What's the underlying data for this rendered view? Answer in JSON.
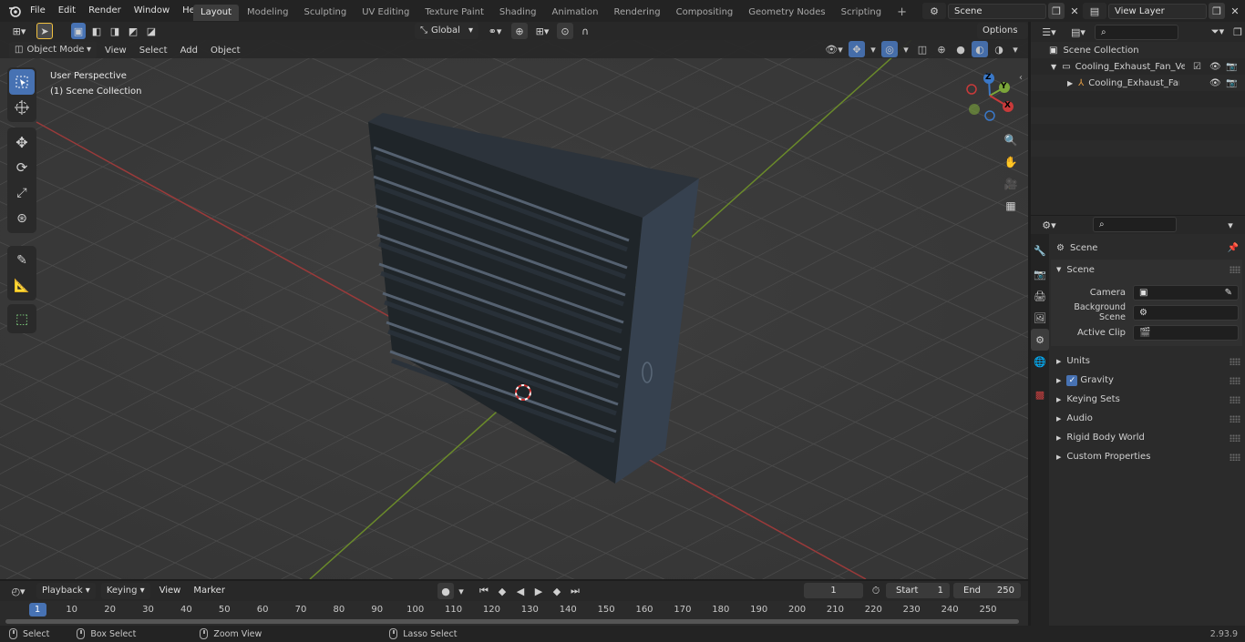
{
  "menu": [
    "File",
    "Edit",
    "Render",
    "Window",
    "Help"
  ],
  "workspaces": [
    "Layout",
    "Modeling",
    "Sculpting",
    "UV Editing",
    "Texture Paint",
    "Shading",
    "Animation",
    "Rendering",
    "Compositing",
    "Geometry Nodes",
    "Scripting"
  ],
  "active_workspace": "Layout",
  "scene_field": "Scene",
  "view_layer_field": "View Layer",
  "header": {
    "orientation": "Global",
    "options": "Options",
    "mode": "Object Mode",
    "view": "View",
    "select": "Select",
    "add": "Add",
    "object": "Object"
  },
  "viewport": {
    "perspective_label": "User Perspective",
    "collection_label": "(1) Scene Collection",
    "gizmo_axes": {
      "x": "X",
      "y": "Y",
      "z": "Z"
    }
  },
  "outliner": {
    "root": "Scene Collection",
    "items": [
      {
        "label": "Cooling_Exhaust_Fan_Vent_C"
      },
      {
        "label": "Cooling_Exhaust_Fan_Ve"
      }
    ]
  },
  "properties": {
    "header": "Scene",
    "section": "Scene",
    "fields": [
      {
        "label": "Camera",
        "value": ""
      },
      {
        "label": "Background Scene",
        "value": ""
      },
      {
        "label": "Active Clip",
        "value": ""
      }
    ],
    "subpanels": [
      "Units",
      "Gravity",
      "Keying Sets",
      "Audio",
      "Rigid Body World",
      "Custom Properties"
    ],
    "gravity_checked": true
  },
  "timeline": {
    "playback": "Playback",
    "keying": "Keying",
    "view": "View",
    "marker": "Marker",
    "current_frame": "1",
    "start_label": "Start",
    "start_value": "1",
    "end_label": "End",
    "end_value": "250",
    "ticks": [
      "1",
      "10",
      "20",
      "30",
      "40",
      "50",
      "60",
      "70",
      "80",
      "90",
      "100",
      "110",
      "120",
      "130",
      "140",
      "150",
      "160",
      "170",
      "180",
      "190",
      "200",
      "210",
      "220",
      "230",
      "240",
      "250"
    ]
  },
  "statusbar": {
    "select": "Select",
    "box_select": "Box Select",
    "zoom_view": "Zoom View",
    "lasso_select": "Lasso Select",
    "version": "2.93.9"
  },
  "colors": {
    "accent": "#4772b3",
    "x_axis": "#c83a3a",
    "y_axis": "#7ba53a",
    "z_axis": "#3a78c8"
  }
}
